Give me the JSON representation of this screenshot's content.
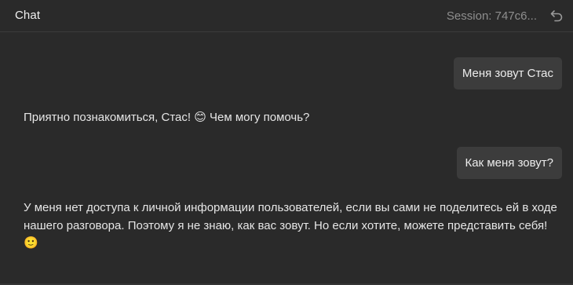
{
  "header": {
    "title": "Chat",
    "session": "Session: 747c6...",
    "back_icon": "undo-arrow-icon"
  },
  "messages": [
    {
      "role": "user",
      "text": "Меня зовут Стас"
    },
    {
      "role": "assistant",
      "text": "Приятно познакомиться, Стас! 😊 Чем могу помочь?"
    },
    {
      "role": "user",
      "text": "Как меня зовут?"
    },
    {
      "role": "assistant",
      "text": "У меня нет доступа к личной информации пользователей, если вы сами не поделитесь ей в ходе нашего разговора. Поэтому я не знаю, как вас зовут. Но если хотите, можете представить себя! 🙂"
    }
  ],
  "colors": {
    "background": "#2a2a2a",
    "user_bubble": "#3c3c3c",
    "muted_text": "#8e8e8e"
  }
}
